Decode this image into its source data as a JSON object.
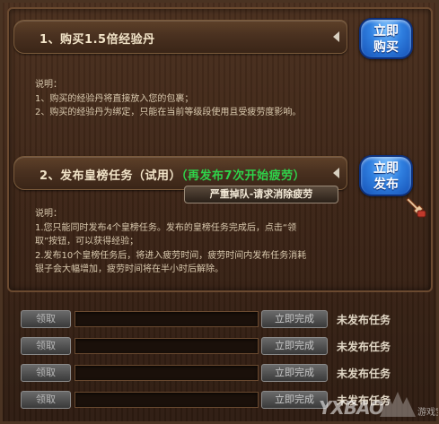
{
  "section1": {
    "title": "1、购买1.5倍经验丹",
    "button": [
      "立即",
      "购买"
    ],
    "desc_lines": [
      "说明：",
      "1、购买的经验丹将直接放入您的包裹；",
      "2、购买的经验丹为绑定，只能在当前等级段使用且受疲劳度影响。"
    ]
  },
  "section2": {
    "title": "2、发布皇榜任务（试用）",
    "hint": "（再发布7次开始疲劳）",
    "button": [
      "立即",
      "发布"
    ],
    "tag": "严重掉队-请求消除疲劳",
    "desc_lines": [
      "说明：",
      "1.您只能同时发布4个皇榜任务。发布的皇榜任务完成后，点击“领",
      "   取”按钮，可以获得经验；",
      "2.发布10个皇榜任务后，将进入疲劳时间，疲劳时间内发布任务消耗",
      "   银子会大幅增加，疲劳时间将在半小时后解除。"
    ]
  },
  "tasks": [
    {
      "claim": "领取",
      "finish": "立即完成",
      "status": "未发布任务"
    },
    {
      "claim": "领取",
      "finish": "立即完成",
      "status": "未发布任务"
    },
    {
      "claim": "领取",
      "finish": "立即完成",
      "status": "未发布任务"
    },
    {
      "claim": "领取",
      "finish": "立即完成",
      "status": "未发布任务"
    }
  ],
  "watermark": {
    "text": "YXBAO",
    "sub": "游戏宝"
  },
  "colors": {
    "hint_green": "#2fd24a",
    "button_blue": "#2f7fe0",
    "wood_dark": "#3b2416"
  }
}
